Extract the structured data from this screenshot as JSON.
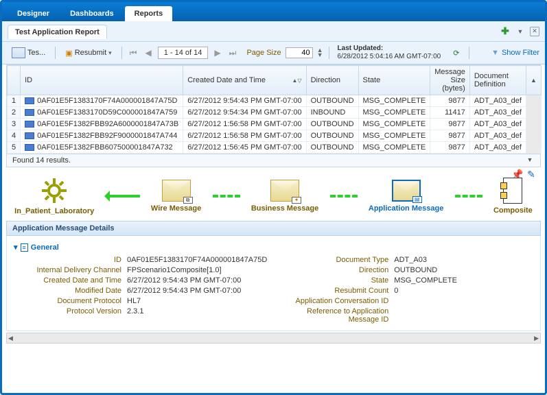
{
  "tabs": {
    "main": [
      "Designer",
      "Dashboards",
      "Reports"
    ],
    "active_main": 2
  },
  "report": {
    "title": "Test Application Report",
    "templates_btn": "Tes...",
    "resubmit_btn": "Resubmit",
    "page_range": "1 - 14 of 14",
    "page_size_label": "Page Size",
    "page_size_value": "40",
    "last_updated_label": "Last Updated:",
    "last_updated_value": "6/28/2012 5:04:16 AM GMT-07:00",
    "show_filter": "Show Filter"
  },
  "grid": {
    "columns": [
      "",
      "ID",
      "Created Date and Time",
      "Direction",
      "State",
      "Message Size (bytes)",
      "Document Definition"
    ],
    "rows": [
      {
        "n": "1",
        "id": "0AF01E5F1383170F74A000001847A75D",
        "created": "6/27/2012 9:54:43 PM GMT-07:00",
        "dir": "OUTBOUND",
        "state": "MSG_COMPLETE",
        "size": "9877",
        "doc": "ADT_A03_def"
      },
      {
        "n": "2",
        "id": "0AF01E5F1383170D59C000001847A759",
        "created": "6/27/2012 9:54:34 PM GMT-07:00",
        "dir": "INBOUND",
        "state": "MSG_COMPLETE",
        "size": "11417",
        "doc": "ADT_A03_def"
      },
      {
        "n": "3",
        "id": "0AF01E5F1382FBB92A6000001847A73B",
        "created": "6/27/2012 1:56:58 PM GMT-07:00",
        "dir": "OUTBOUND",
        "state": "MSG_COMPLETE",
        "size": "9877",
        "doc": "ADT_A03_def"
      },
      {
        "n": "4",
        "id": "0AF01E5F1382FBB92F9000001847A744",
        "created": "6/27/2012 1:56:58 PM GMT-07:00",
        "dir": "OUTBOUND",
        "state": "MSG_COMPLETE",
        "size": "9877",
        "doc": "ADT_A03_def"
      },
      {
        "n": "5",
        "id": "0AF01E5F1382FBB607500001847A732",
        "created": "6/27/2012 1:56:45 PM GMT-07:00",
        "dir": "OUTBOUND",
        "state": "MSG_COMPLETE",
        "size": "9877",
        "doc": "ADT_A03_def"
      }
    ],
    "footer": "Found 14 results."
  },
  "flow": {
    "endpoint": "In_Patient_Laboratory",
    "wire": "Wire Message",
    "business": "Business Message",
    "application": "Application Message",
    "composite": "Composite"
  },
  "details": {
    "panel_title": "Application Message Details",
    "section": "General",
    "left": [
      {
        "k": "ID",
        "v": "0AF01E5F1383170F74A000001847A75D"
      },
      {
        "k": "Internal Delivery Channel",
        "v": "FPScenario1Composite[1.0]"
      },
      {
        "k": "Created Date and Time",
        "v": "6/27/2012 9:54:43 PM GMT-07:00"
      },
      {
        "k": "Modified Date",
        "v": "6/27/2012 9:54:43 PM GMT-07:00"
      },
      {
        "k": "Document Protocol",
        "v": "HL7"
      },
      {
        "k": "Protocol Version",
        "v": "2.3.1"
      }
    ],
    "right": [
      {
        "k": "Document Type",
        "v": "ADT_A03"
      },
      {
        "k": "Direction",
        "v": "OUTBOUND"
      },
      {
        "k": "State",
        "v": "MSG_COMPLETE"
      },
      {
        "k": "Resubmit Count",
        "v": "0"
      },
      {
        "k": "Application Conversation ID",
        "v": ""
      },
      {
        "k": "Reference to Application Message ID",
        "v": ""
      }
    ]
  }
}
